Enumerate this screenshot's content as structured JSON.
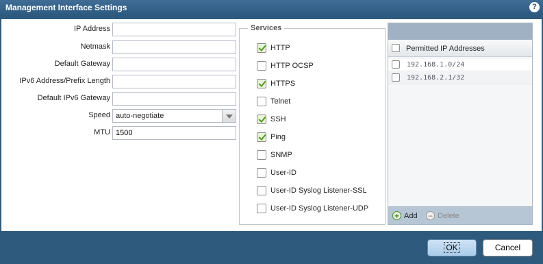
{
  "dialog": {
    "title": "Management Interface Settings",
    "help_icon": "?"
  },
  "form": {
    "ip_address": {
      "label": "IP Address",
      "value": ""
    },
    "netmask": {
      "label": "Netmask",
      "value": ""
    },
    "default_gateway": {
      "label": "Default Gateway",
      "value": ""
    },
    "ipv6_address": {
      "label": "IPv6 Address/Prefix Length",
      "value": ""
    },
    "default_ipv6_gateway": {
      "label": "Default IPv6 Gateway",
      "value": ""
    },
    "speed": {
      "label": "Speed",
      "value": "auto-negotiate"
    },
    "mtu": {
      "label": "MTU",
      "value": "1500"
    }
  },
  "services": {
    "legend": "Services",
    "items": [
      {
        "label": "HTTP",
        "checked": true
      },
      {
        "label": "HTTP OCSP",
        "checked": false
      },
      {
        "label": "HTTPS",
        "checked": true
      },
      {
        "label": "Telnet",
        "checked": false
      },
      {
        "label": "SSH",
        "checked": true
      },
      {
        "label": "Ping",
        "checked": true
      },
      {
        "label": "SNMP",
        "checked": false
      },
      {
        "label": "User-ID",
        "checked": false
      },
      {
        "label": "User-ID Syslog Listener-SSL",
        "checked": false
      },
      {
        "label": "User-ID Syslog Listener-UDP",
        "checked": false
      }
    ]
  },
  "permitted_ips": {
    "header": "Permitted IP Addresses",
    "rows": [
      "192.168.1.0/24",
      "192.168.2.1/32"
    ],
    "add_label": "Add",
    "delete_label": "Delete"
  },
  "footer": {
    "ok_label": "OK",
    "cancel_label": "Cancel"
  },
  "colors": {
    "titlebar": "#2d5a80",
    "footer": "#2e5a7e",
    "check": "#4f9a1c"
  }
}
